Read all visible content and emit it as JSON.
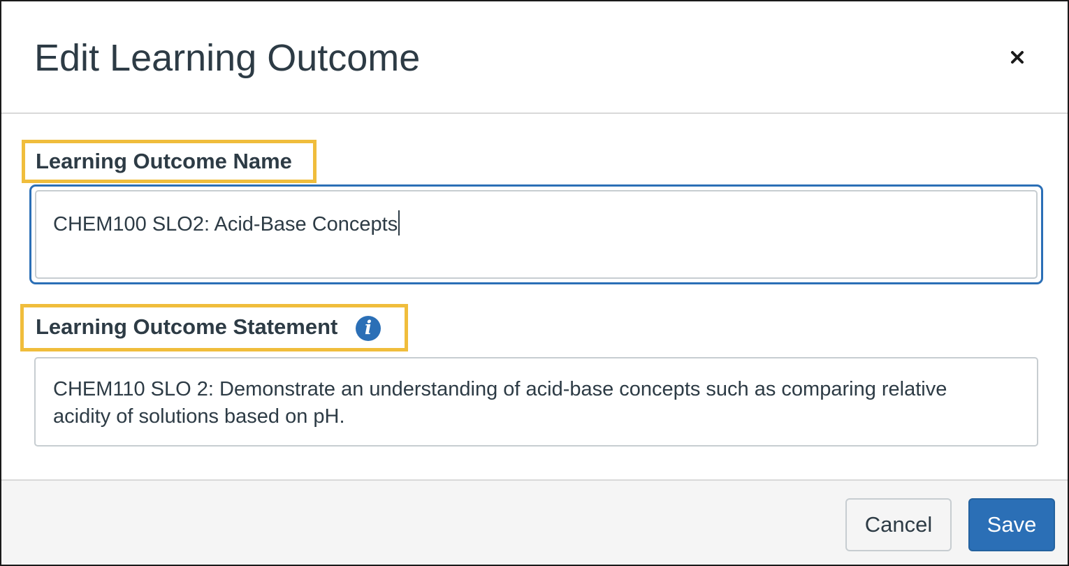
{
  "dialog": {
    "title": "Edit Learning Outcome",
    "close_icon": "close-icon"
  },
  "name_field": {
    "label": "Learning Outcome Name",
    "value": "CHEM100 SLO2: Acid-Base Concepts",
    "focused": true
  },
  "statement_field": {
    "label": "Learning Outcome Statement",
    "info_icon": "info-icon",
    "info_glyph": "i",
    "value": "CHEM110 SLO 2: Demonstrate an understanding of acid-base concepts such as comparing relative acidity of solutions based on pH."
  },
  "footer": {
    "cancel_label": "Cancel",
    "save_label": "Save"
  },
  "colors": {
    "highlight": "#f0bd3c",
    "primary": "#2b6fb6",
    "text": "#2d3b45",
    "footer_bg": "#f5f5f5"
  }
}
